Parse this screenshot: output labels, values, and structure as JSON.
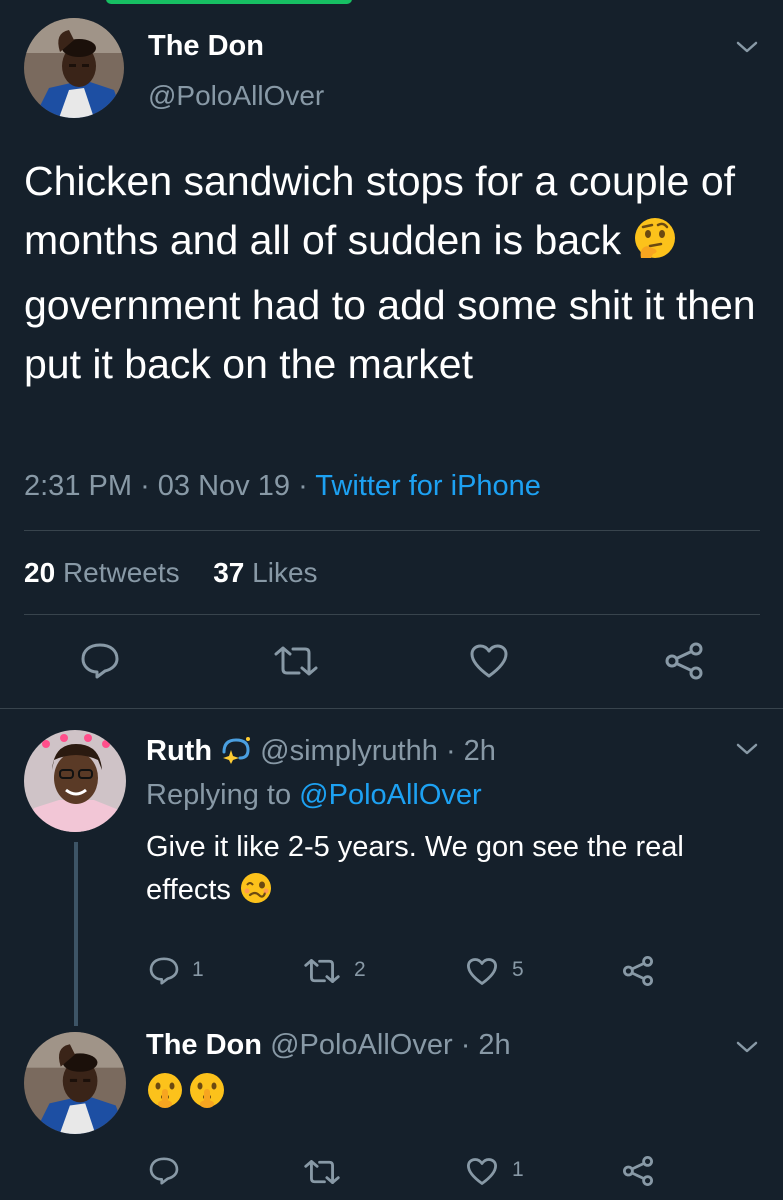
{
  "main_tweet": {
    "name": "The Don",
    "handle": "@PoloAllOver",
    "text_part1": "Chicken sandwich stops for a couple of months and all of sudden is back",
    "text_emoji": "thinking-face-emoji",
    "text_part2": "government had to add some shit it then put it back on the market",
    "time": "2:31 PM",
    "date": "03 Nov 19",
    "source": "Twitter for iPhone",
    "retweet_count": "20",
    "retweets_label": "Retweets",
    "like_count": "37",
    "likes_label": "Likes"
  },
  "reply1": {
    "name": "Ruth",
    "badge_icon": "dizzy-sparkle-emoji",
    "handle": "@simplyruthh",
    "time": "2h",
    "replying_prefix": "Replying to",
    "replying_to": "@PoloAllOver",
    "text": "Give it like 2-5 years. We gon see the real effects",
    "text_emoji": "woozy-face-emoji",
    "reply_count": "1",
    "retweet_count": "2",
    "like_count": "5"
  },
  "reply2": {
    "name": "The Don",
    "handle": "@PoloAllOver",
    "time": "2h",
    "emojis": [
      "shushing-face-emoji",
      "shushing-face-emoji"
    ],
    "reply_count": "",
    "retweet_count": "",
    "like_count": "1"
  },
  "separator": "·",
  "colors": {
    "background": "#15202b",
    "text": "#ffffff",
    "muted": "#8899a6",
    "accent": "#1da1f2",
    "divider": "#38444d"
  }
}
